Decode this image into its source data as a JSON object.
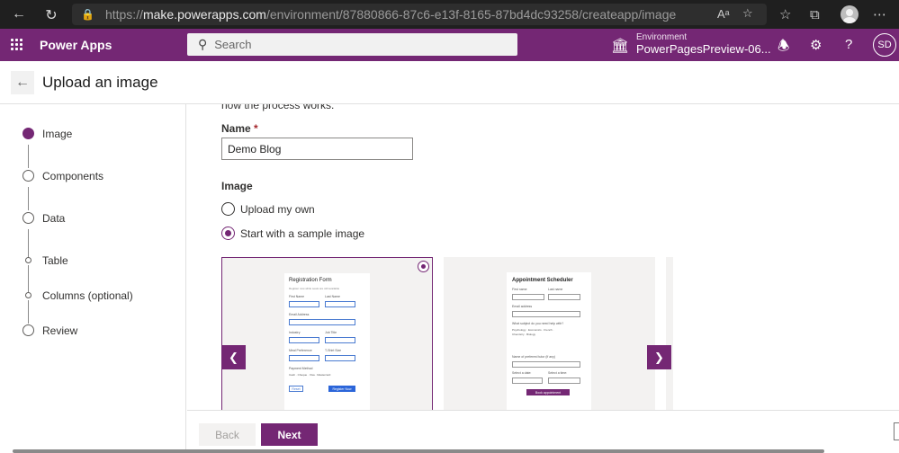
{
  "browser": {
    "url_prefix": "https://",
    "url_host": "make.powerapps.com",
    "url_path": "/environment/87880866-87c6-e13f-8165-87bd4dc93258/createapp/image"
  },
  "appbar": {
    "brand": "Power Apps",
    "search_placeholder": "Search",
    "env_label": "Environment",
    "env_name": "PowerPagesPreview-06...",
    "avatar_initials": "SD"
  },
  "page": {
    "title": "Upload an image"
  },
  "steps": [
    {
      "label": "Image",
      "state": "active"
    },
    {
      "label": "Components",
      "state": "pending"
    },
    {
      "label": "Data",
      "state": "pending"
    },
    {
      "label": "Table",
      "state": "substep"
    },
    {
      "label": "Columns (optional)",
      "state": "substep"
    },
    {
      "label": "Review",
      "state": "pending"
    }
  ],
  "form": {
    "intro_tail": "how the process works.",
    "name_label": "Name",
    "required_mark": "*",
    "name_value": "Demo Blog",
    "image_label": "Image",
    "options": [
      {
        "label": "Upload my own",
        "selected": false
      },
      {
        "label": "Start with a sample image",
        "selected": true
      }
    ]
  },
  "samples": {
    "registration": {
      "title": "Registration Form",
      "subtitle": "Register now while seats are still available",
      "first_name": "First Name",
      "last_name": "Last Name",
      "email": "Email Address",
      "industry": "Industry",
      "job_title": "Job Title",
      "meal": "Meal Preference",
      "tshirt": "T-Shirt Size",
      "payment": "Payment Method",
      "pay_options": "Cash · Cheque · Visa · Mastercard",
      "reset": "Reset",
      "register": "Register Now"
    },
    "appointment": {
      "title": "Appointment Scheduler",
      "first_name": "First name",
      "last_name": "Last name",
      "email": "Email address",
      "subject_q": "What subject do you need help with?",
      "subjects": "Psychology · Economics · French · Chemistry · Biology",
      "tutor": "Name of preferred tutor (if any)",
      "date": "Select a date:",
      "time": "Select a time:",
      "book": "Book appointment"
    }
  },
  "footer": {
    "back": "Back",
    "next": "Next"
  }
}
